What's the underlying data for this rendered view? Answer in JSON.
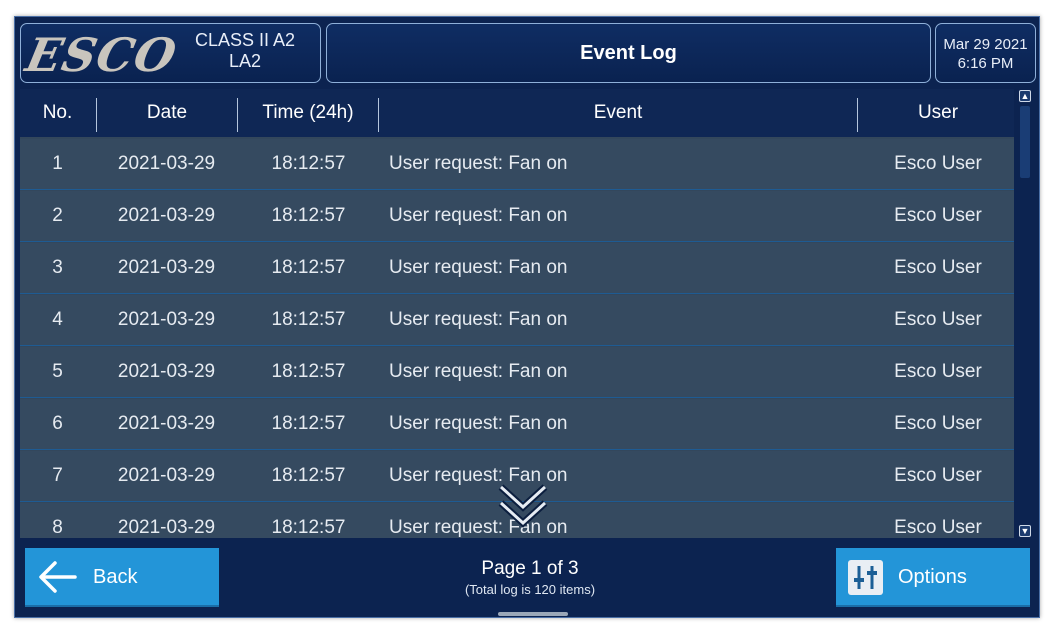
{
  "header": {
    "logo_text": "ESCO",
    "model_line1": "CLASS II A2",
    "model_line2": "LA2",
    "title": "Event Log",
    "date": "Mar 29 2021",
    "time": "6:16 PM"
  },
  "table": {
    "columns": [
      "No.",
      "Date",
      "Time (24h)",
      "Event",
      "User"
    ],
    "rows": [
      {
        "no": "1",
        "date": "2021-03-29",
        "time": "18:12:57",
        "event": "User request: Fan on",
        "user": "Esco User"
      },
      {
        "no": "2",
        "date": "2021-03-29",
        "time": "18:12:57",
        "event": "User request: Fan on",
        "user": "Esco User"
      },
      {
        "no": "3",
        "date": "2021-03-29",
        "time": "18:12:57",
        "event": "User request: Fan on",
        "user": "Esco User"
      },
      {
        "no": "4",
        "date": "2021-03-29",
        "time": "18:12:57",
        "event": "User request: Fan on",
        "user": "Esco User"
      },
      {
        "no": "5",
        "date": "2021-03-29",
        "time": "18:12:57",
        "event": "User request: Fan on",
        "user": "Esco User"
      },
      {
        "no": "6",
        "date": "2021-03-29",
        "time": "18:12:57",
        "event": "User request: Fan on",
        "user": "Esco User"
      },
      {
        "no": "7",
        "date": "2021-03-29",
        "time": "18:12:57",
        "event": "User request: Fan on",
        "user": "Esco User"
      },
      {
        "no": "8",
        "date": "2021-03-29",
        "time": "18:12:57",
        "event": "User request: Fan on",
        "user": "Esco User"
      }
    ]
  },
  "footer": {
    "back_label": "Back",
    "page_text": "Page 1 of 3",
    "total_text": "(Total log is 120 items)",
    "options_label": "Options"
  },
  "icons": {
    "back": "arrow-left-icon",
    "options": "sliders-icon",
    "more": "double-chevron-down-icon",
    "scroll_up": "scroll-up-icon",
    "scroll_down": "scroll-down-icon"
  },
  "colors": {
    "background": "#0c2350",
    "accent_button": "#2395d8",
    "row": "#354a60",
    "header_row": "#0f2755"
  }
}
